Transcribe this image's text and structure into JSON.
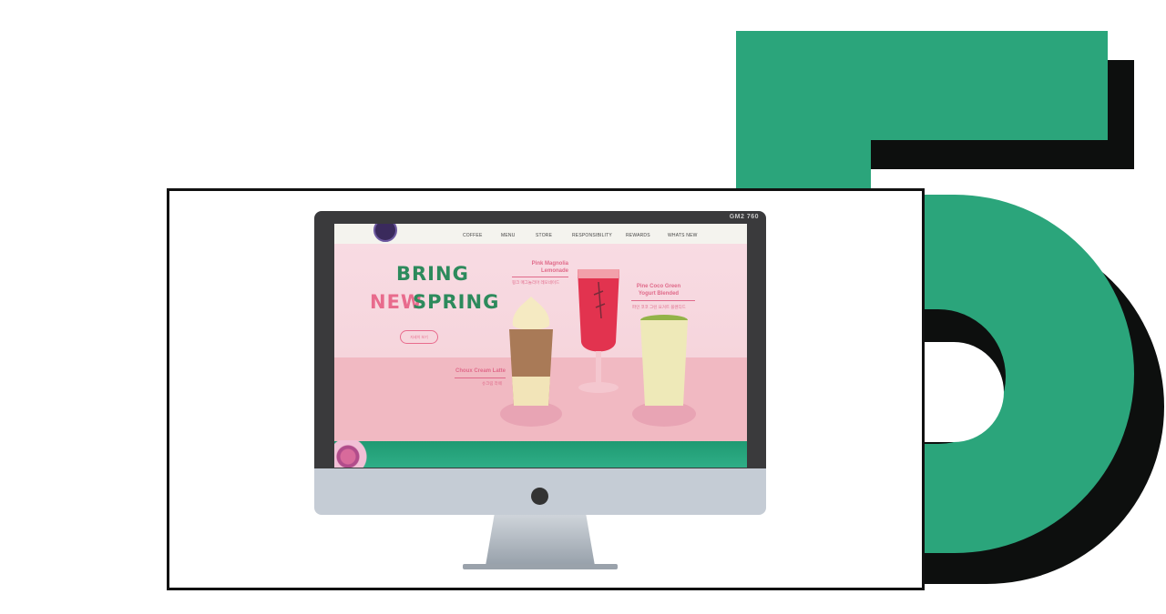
{
  "monitor": {
    "brand": "GM2 760"
  },
  "nav": {
    "items": [
      "COFFEE",
      "MENU",
      "STORE",
      "RESPONSIBILITY",
      "REWARDS",
      "WHATS NEW"
    ]
  },
  "hero": {
    "headline_line1": "BRING",
    "headline_line2_accent": "NEW",
    "headline_line2_main": "SPRING",
    "cta_label": "자세히 보기"
  },
  "drinks": [
    {
      "name": "Pink Magnolia\nLemonade",
      "name_line1": "Pink Magnolia",
      "name_line2": "Lemonade",
      "subtitle": "핑크 매그놀리아 레모네이드"
    },
    {
      "name_line1": "Pine Coco Green",
      "name_line2": "Yogurt Blended",
      "subtitle": "파인 코코 그린 요거트 블렌디드"
    },
    {
      "name_line1": "Choux Cream Latte",
      "subtitle": "슈크림 라떼"
    }
  ],
  "colors": {
    "accent_green": "#2ba57b",
    "accent_pink": "#e86b8d"
  }
}
